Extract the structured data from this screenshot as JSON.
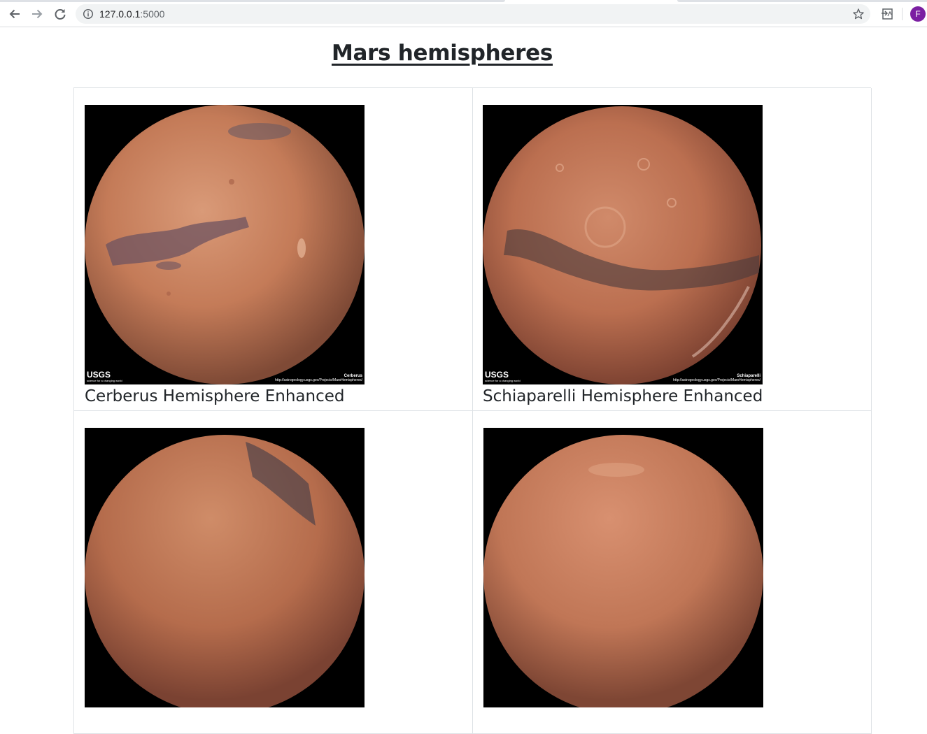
{
  "browser": {
    "url_host": "127.0.0.1",
    "url_port": ":5000",
    "avatar_letter": "F",
    "icons": [
      "back-arrow-icon",
      "forward-arrow-icon",
      "reload-icon",
      "info-icon",
      "star-icon",
      "extension-icon"
    ]
  },
  "page": {
    "title": "Mars hemispheres"
  },
  "hemispheres": [
    {
      "caption": "Cerberus Hemisphere Enhanced",
      "image_brand": "USGS",
      "image_brand_sub": "science for a changing world",
      "image_label": "Cerberus",
      "image_credit": "http://astrogeology.usgs.gov/Projects/MarsHemispheres/"
    },
    {
      "caption": "Schiaparelli Hemisphere Enhanced",
      "image_brand": "USGS",
      "image_brand_sub": "science for a changing world",
      "image_label": "Schiaparelli",
      "image_credit": "http://astrogeology.usgs.gov/Projects/MarsHemispheres/"
    },
    {
      "caption": ""
    },
    {
      "caption": ""
    }
  ],
  "colors": {
    "mars_base": "#c27a5a",
    "mars_dark": "#6b4a45",
    "avatar": "#7b1fa2",
    "table_border": "#dee2e6"
  }
}
